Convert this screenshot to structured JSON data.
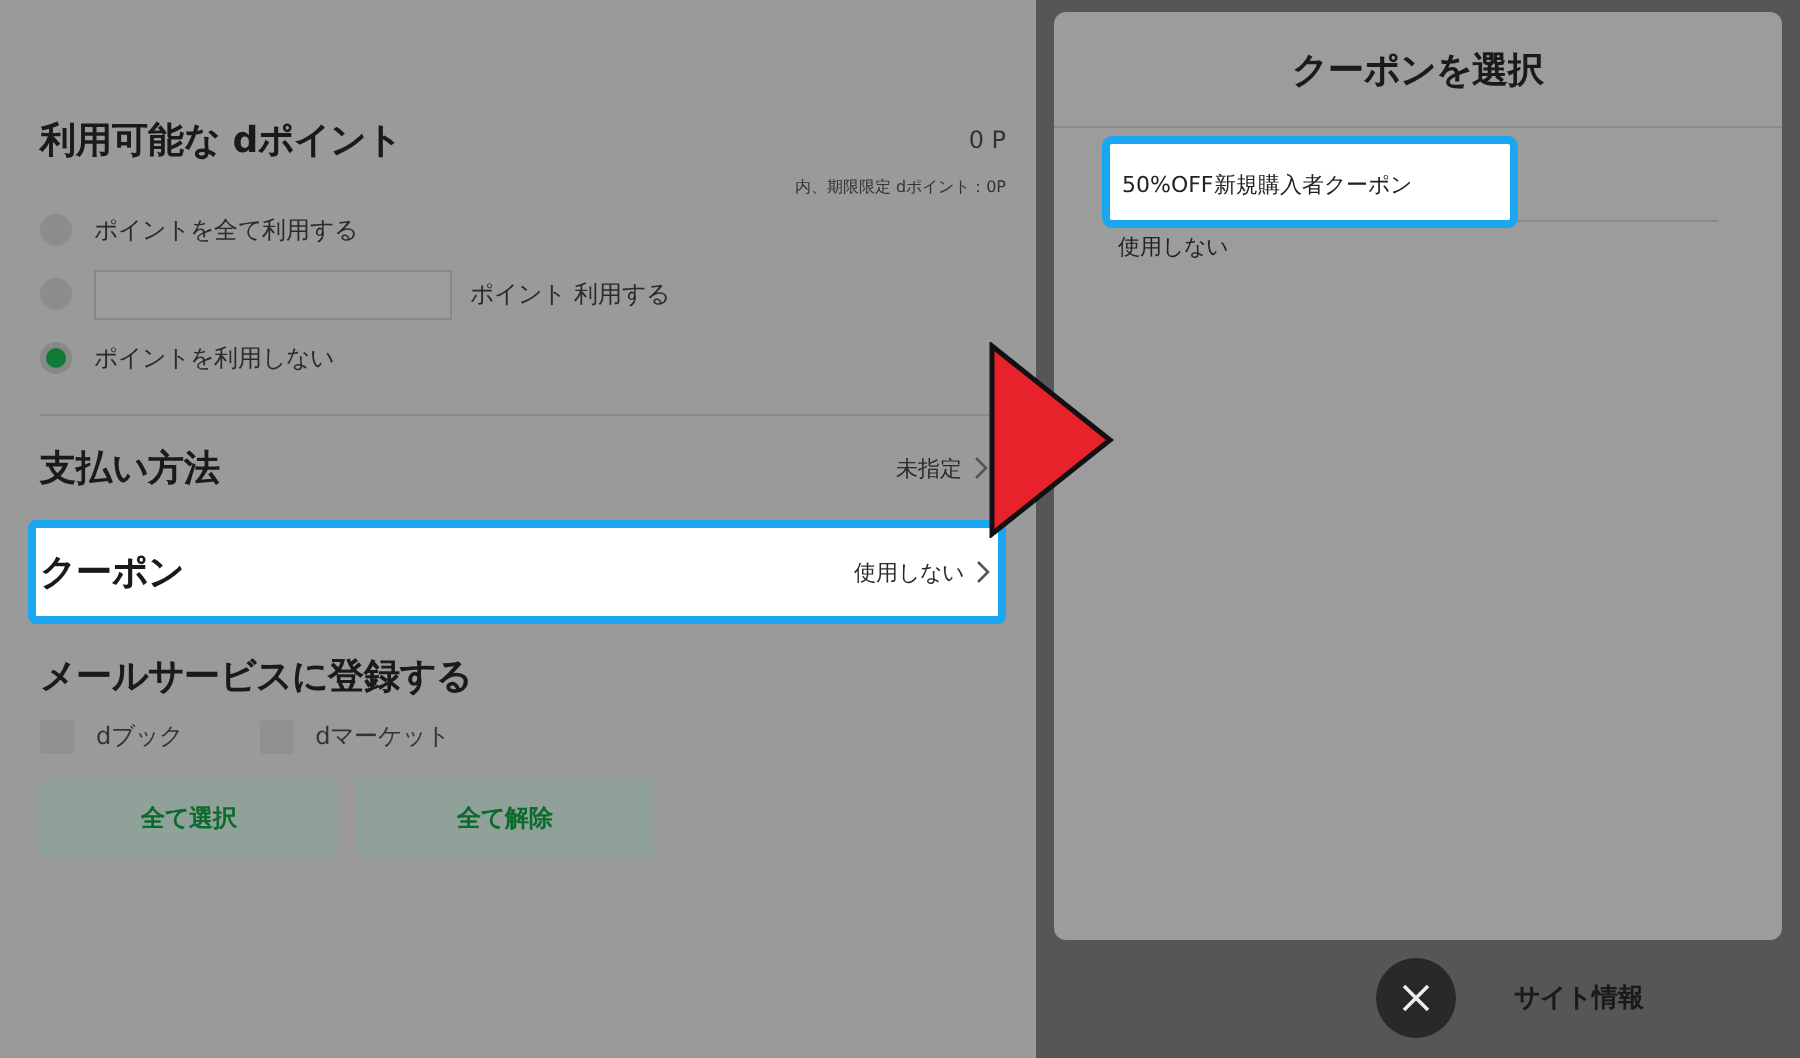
{
  "points": {
    "title": "利用可能な dポイント",
    "amount": "0 P",
    "note": "内、期限限定 dポイント：0P",
    "options": [
      {
        "kind": "all",
        "label": "ポイントを全て利用する",
        "selected": false
      },
      {
        "kind": "amount",
        "label": "ポイント 利用する",
        "selected": false
      },
      {
        "kind": "none",
        "label": "ポイントを利用しない",
        "selected": true
      }
    ]
  },
  "payment": {
    "title": "支払い方法",
    "value": "未指定"
  },
  "coupon": {
    "title": "クーポン",
    "value": "使用しない",
    "highlighted": true
  },
  "mail": {
    "title": "メールサービスに登録する",
    "services": [
      {
        "label": "dブック",
        "checked": false
      },
      {
        "label": "dマーケット",
        "checked": false
      }
    ],
    "buttons": [
      "全て選択",
      "全て解除"
    ]
  },
  "coupon_dialog": {
    "title": "クーポンを選択",
    "options": [
      {
        "label": "50%OFF新規購入者クーポン",
        "highlighted": true
      },
      {
        "label": "使用しない",
        "highlighted": false
      }
    ]
  },
  "footer": {
    "link": "サイト情報"
  }
}
